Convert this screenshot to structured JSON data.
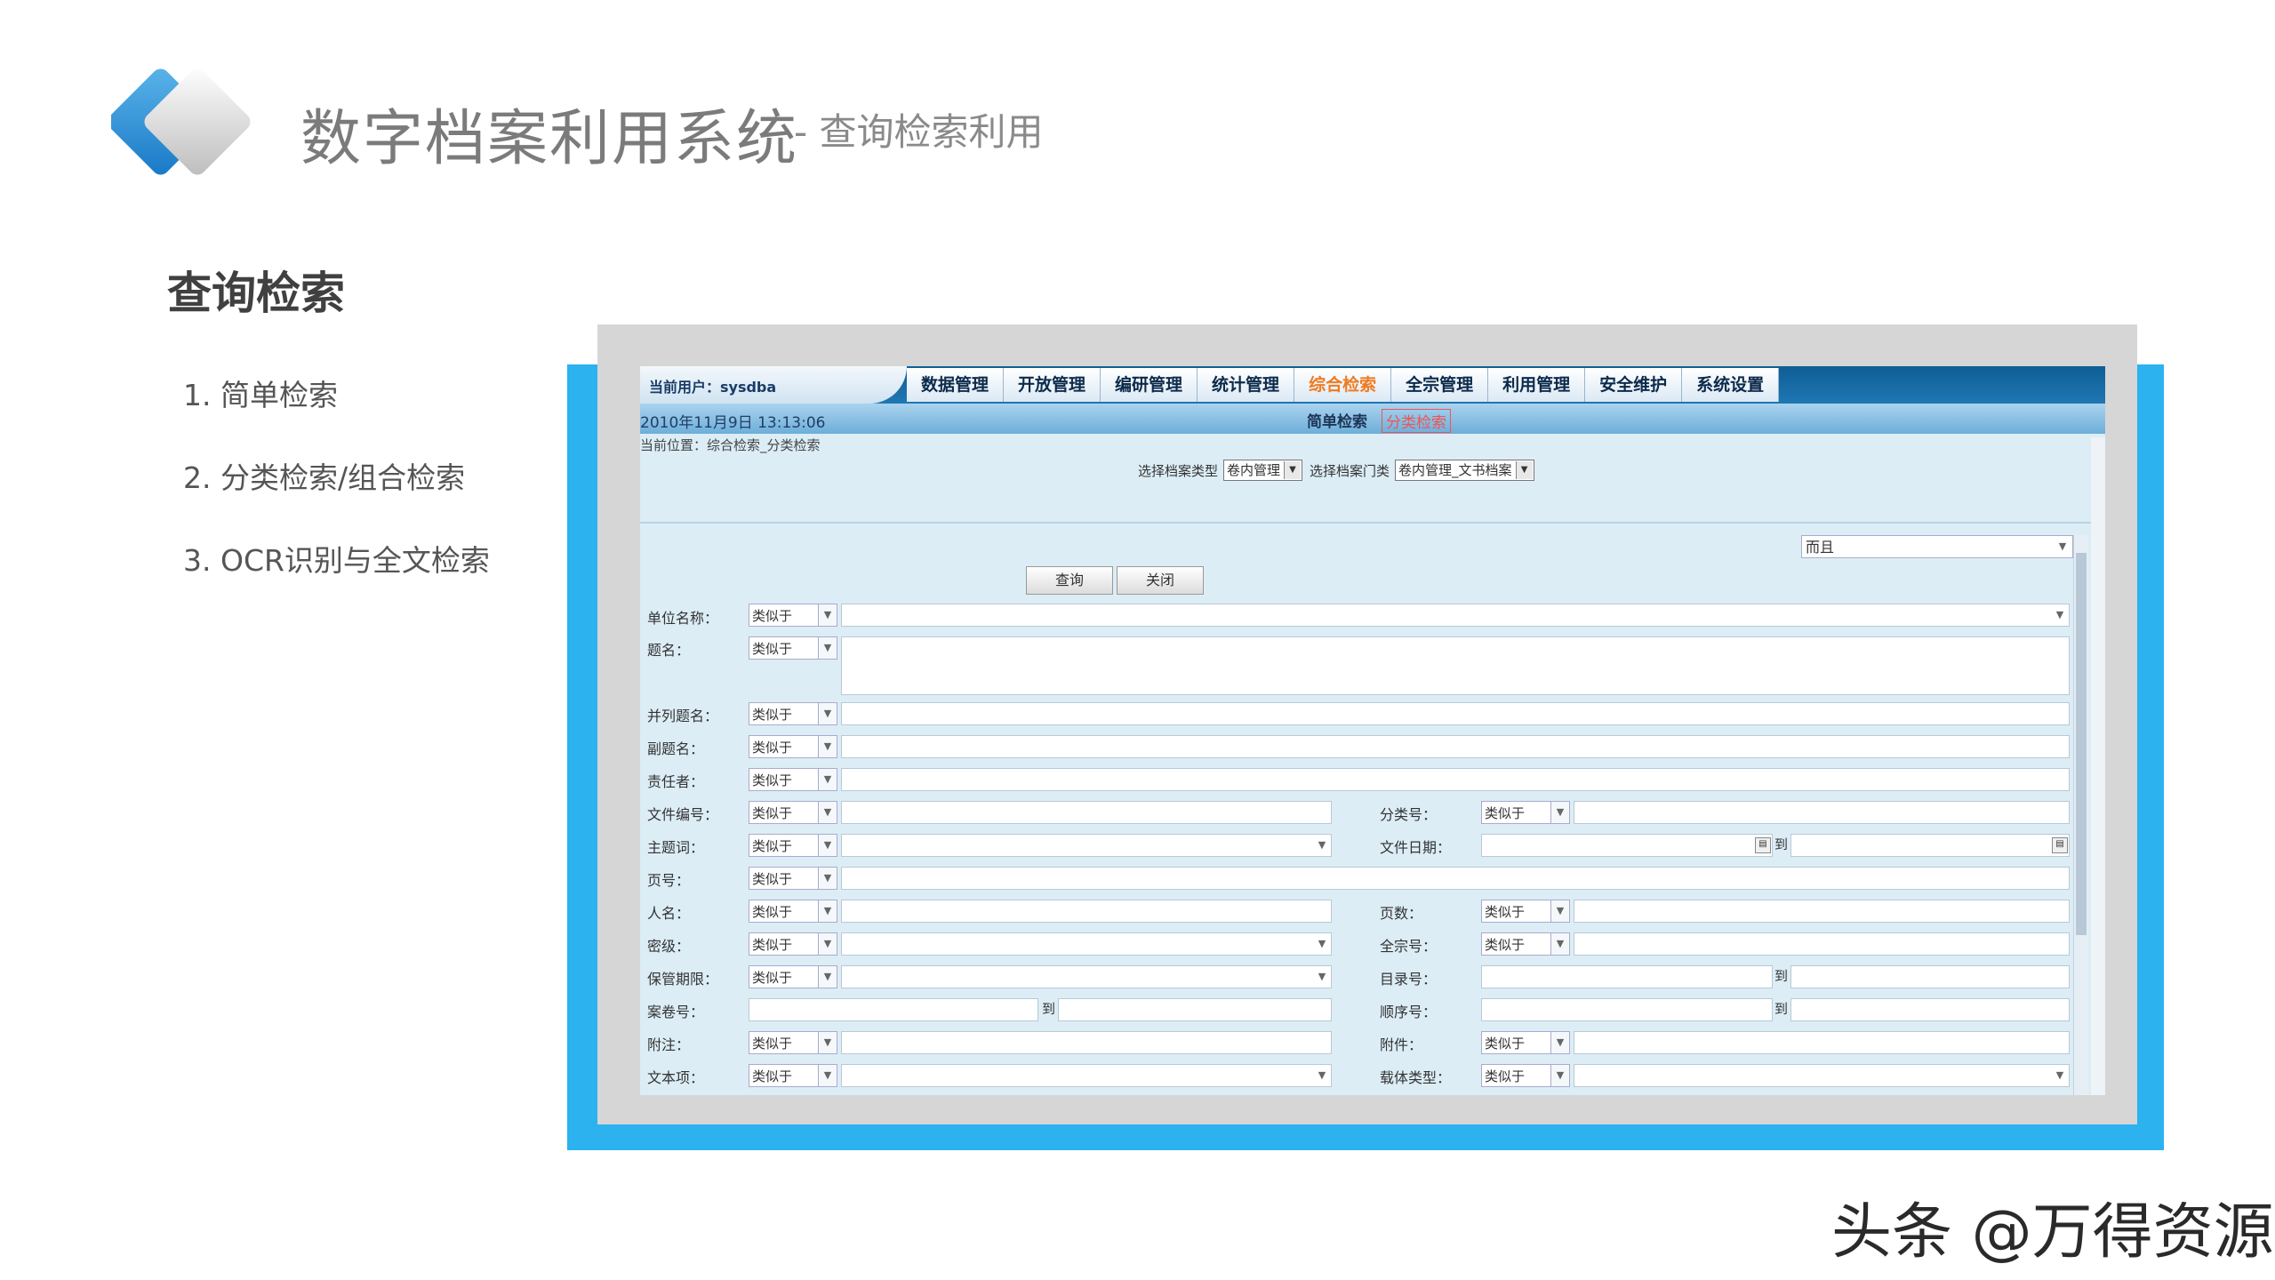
{
  "header": {
    "title": "数字档案利用系统",
    "subtitle": "- 查询检索利用"
  },
  "section_title": "查询检索",
  "menu": [
    "1. 简单检索",
    "2. 分类检索/组合检索",
    "3. OCR识别与全文检索"
  ],
  "watermark": "头条 @万得资源",
  "app": {
    "current_user": "当前用户：sysdba",
    "nav": [
      "数据管理",
      "开放管理",
      "编研管理",
      "统计管理",
      "综合检索",
      "全宗管理",
      "利用管理",
      "安全维护",
      "系统设置"
    ],
    "active_nav": "综合检索",
    "datetime": "2010年11月9日  13:13:06",
    "subtabs": [
      "简单检索",
      "分类检索"
    ],
    "breadcrumb": "当前位置：综合检索_分类检索",
    "select_type_label": "选择档案类型",
    "select_type_value": "卷内管理",
    "select_category_label": "选择档案门类",
    "select_category_value": "卷内管理_文书档案",
    "logic_value": "而且",
    "btn_query": "查询",
    "btn_close": "关闭",
    "op": "类似于",
    "to": "到",
    "labels": {
      "unit": "单位名称：",
      "title": "题名：",
      "parallel_title": "并列题名：",
      "sub_title": "副题名：",
      "responsible": "责任者：",
      "doc_no": "文件编号：",
      "class_no": "分类号：",
      "subject": "主题词：",
      "doc_date": "文件日期：",
      "page_no": "页号：",
      "person": "人名：",
      "pages": "页数：",
      "secret": "密级：",
      "fonds_no": "全宗号：",
      "retention": "保管期限：",
      "catalog_no": "目录号：",
      "volume_no": "案卷号：",
      "order_no": "顺序号：",
      "note": "附注：",
      "attachment": "附件：",
      "text_item": "文本项：",
      "carrier": "载体类型："
    }
  },
  "colors": {
    "frame_blue": "#2bb2ef",
    "frame_gray": "#d6d6d6",
    "nav_active": "#ef7b22"
  }
}
